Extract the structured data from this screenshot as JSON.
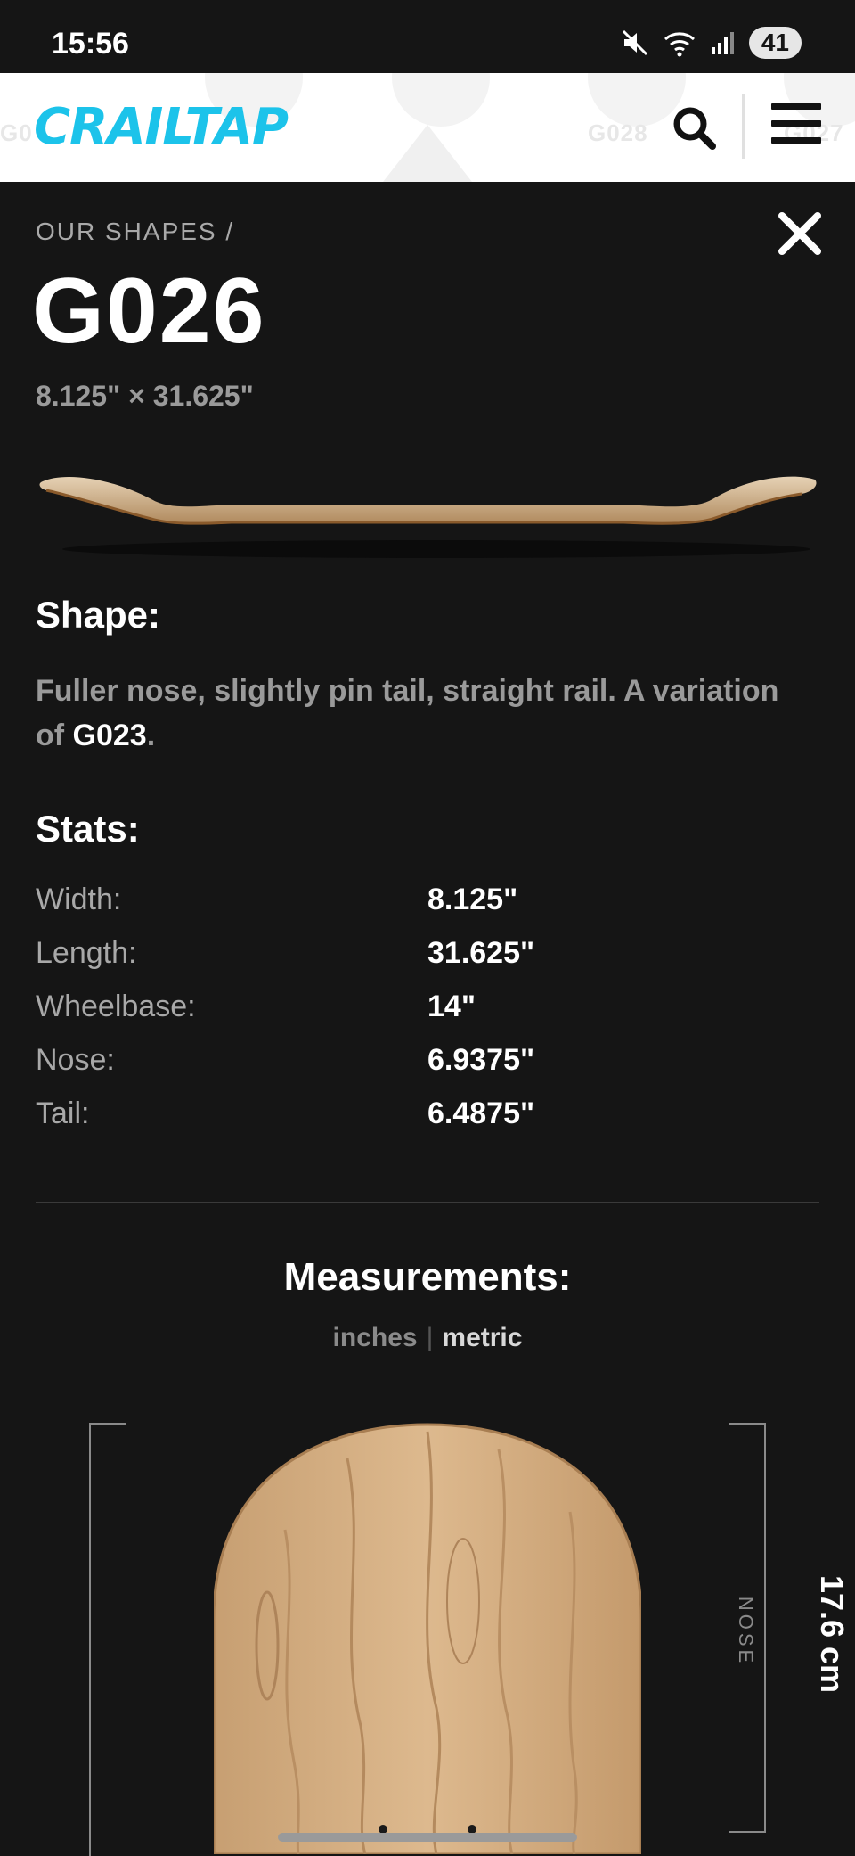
{
  "status_bar": {
    "time": "15:56",
    "battery": "41"
  },
  "header": {
    "logo_text": "CRAILTAP",
    "ghost_tabs": [
      "G0",
      "G028",
      "G027"
    ]
  },
  "page": {
    "breadcrumb": "OUR SHAPES /",
    "title": "G026",
    "dimensions": "8.125\" × 31.625\""
  },
  "shape": {
    "heading": "Shape:",
    "description": "Fuller nose, slightly pin tail, straight rail. A variation of ",
    "link_text": "G023",
    "description_end": "."
  },
  "stats": {
    "heading": "Stats:",
    "rows": [
      {
        "label": "Width:",
        "value": "8.125\""
      },
      {
        "label": "Length:",
        "value": "31.625\""
      },
      {
        "label": "Wheelbase:",
        "value": "14\""
      },
      {
        "label": "Nose:",
        "value": "6.9375\""
      },
      {
        "label": "Tail:",
        "value": "6.4875\""
      }
    ]
  },
  "measurements": {
    "heading": "Measurements:",
    "units": {
      "inches": "inches",
      "separator": "|",
      "metric": "metric",
      "active": "metric"
    },
    "nose_label": "NOSE",
    "nose_value": "17.6 cm"
  },
  "colors": {
    "accent": "#1cc3ea",
    "background": "#151515",
    "wood": "#d8b48a"
  }
}
